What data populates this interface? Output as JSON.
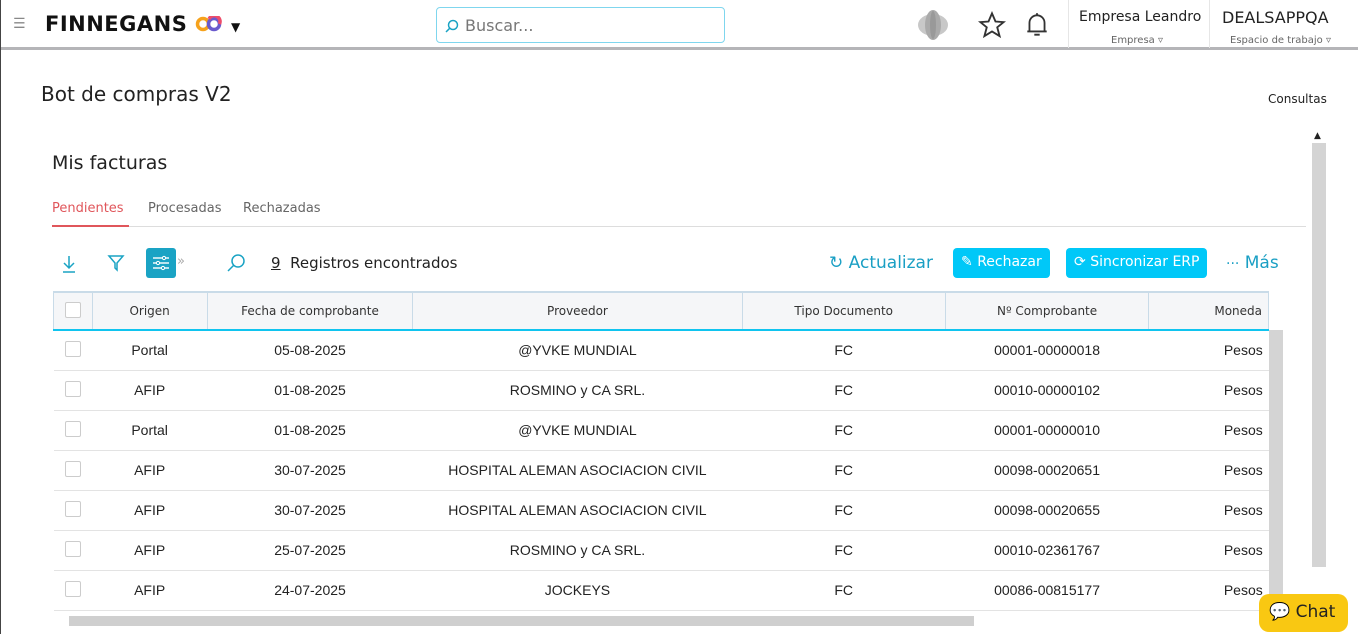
{
  "topbar": {
    "brand": "FINNEGANS",
    "search_placeholder": "Buscar...",
    "company": "Empresa Leandro",
    "company_label": "Empresa",
    "workspace": "DEALSAPPQA",
    "workspace_label": "Espacio de trabajo"
  },
  "page": {
    "title": "Bot de compras V2",
    "consultas": "Consultas"
  },
  "card": {
    "title": "Mis facturas",
    "tabs": [
      {
        "label": "Pendientes",
        "active": true
      },
      {
        "label": "Procesadas"
      },
      {
        "label": "Rechazadas"
      }
    ]
  },
  "toolbar": {
    "count": "9",
    "count_label": "Registros encontrados",
    "refresh": "Actualizar",
    "reject": "Rechazar",
    "sync": "Sincronizar ERP",
    "more": "Más"
  },
  "table": {
    "columns": [
      "Origen",
      "Fecha de comprobante",
      "Proveedor",
      "Tipo Documento",
      "Nº Comprobante",
      "Moneda"
    ],
    "rows": [
      [
        "Portal",
        "05-08-2025",
        "@YVKE MUNDIAL",
        "FC",
        "00001-00000018",
        "Pesos"
      ],
      [
        "AFIP",
        "01-08-2025",
        "ROSMINO y CA SRL.",
        "FC",
        "00010-00000102",
        "Pesos"
      ],
      [
        "Portal",
        "01-08-2025",
        "@YVKE MUNDIAL",
        "FC",
        "00001-00000010",
        "Pesos"
      ],
      [
        "AFIP",
        "30-07-2025",
        "HOSPITAL ALEMAN ASOCIACION CIVIL",
        "FC",
        "00098-00020651",
        "Pesos"
      ],
      [
        "AFIP",
        "30-07-2025",
        "HOSPITAL ALEMAN ASOCIACION CIVIL",
        "FC",
        "00098-00020655",
        "Pesos"
      ],
      [
        "AFIP",
        "25-07-2025",
        "ROSMINO y CA SRL.",
        "FC",
        "00010-02361767",
        "Pesos"
      ],
      [
        "AFIP",
        "24-07-2025",
        "JOCKEYS",
        "FC",
        "00086-00815177",
        "Pesos"
      ]
    ]
  },
  "chat": {
    "label": "Chat"
  },
  "colors": {
    "accent": "#00c8f8",
    "tab_active": "#e0565b",
    "chat": "#f9c812"
  }
}
